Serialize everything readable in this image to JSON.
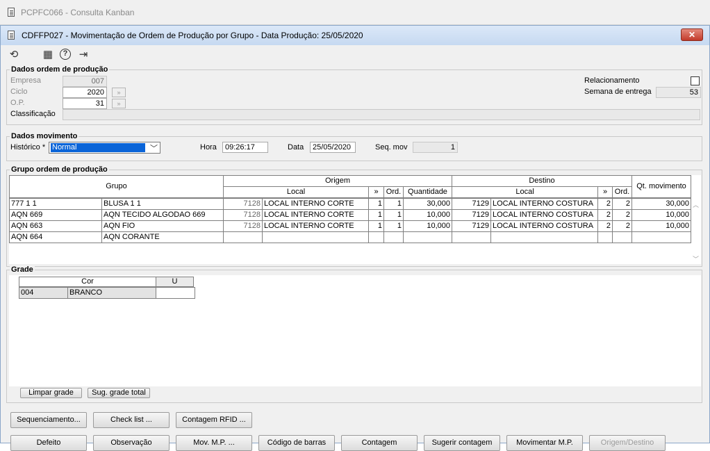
{
  "outer_window": {
    "title": "PCPFC066 - Consulta Kanban"
  },
  "window": {
    "title": "CDFFP027 - Movimentação de Ordem de Produção por Grupo - Data Produção: 25/05/2020",
    "close_symbol": "✕"
  },
  "toolbar": {
    "icons": [
      "refresh-icon",
      "calendar-icon",
      "help-icon",
      "exit-icon"
    ],
    "glyphs": {
      "refresh": "⟲",
      "calendar": "▦",
      "help": "?",
      "exit": "⇥"
    }
  },
  "dados_op": {
    "legend": "Dados ordem de produção",
    "empresa_label": "Empresa",
    "empresa_value": "007",
    "ciclo_label": "Ciclo",
    "ciclo_value": "2020",
    "op_label": "O.P.",
    "op_value": "31",
    "classificacao_label": "Classificação",
    "classificacao_value": "",
    "relacionamento_label": "Relacionamento",
    "relacionamento_checked": false,
    "semana_label": "Semana de entrega",
    "semana_value": "53",
    "spin_glyph": "»"
  },
  "dados_mov": {
    "legend": "Dados movimento",
    "historico_label": "Histórico *",
    "historico_value": "Normal",
    "hora_label": "Hora",
    "hora_value": "09:26:17",
    "data_label": "Data",
    "data_value": "25/05/2020",
    "seq_label": "Seq. mov",
    "seq_value": "1",
    "dropdown_glyph": "﹀"
  },
  "grupo_op": {
    "legend": "Grupo ordem de produção",
    "headers": {
      "grupo": "Grupo",
      "origem": "Origem",
      "destino": "Destino",
      "local": "Local",
      "arrows": "»",
      "ord": "Ord.",
      "quantidade": "Quantidade",
      "qt_movimento": "Qt. movimento"
    },
    "rows": [
      {
        "grupo_code": "777 1 1",
        "grupo_desc": "BLUSA 1 1",
        "orig_code": "7128",
        "orig_local": "LOCAL INTERNO CORTE",
        "orig_seq": "1",
        "orig_ord": "1",
        "quantidade": "30,000",
        "dest_code": "7129",
        "dest_local": "LOCAL INTERNO COSTURA",
        "dest_seq": "2",
        "dest_ord": "2",
        "qt_mov": "30,000"
      },
      {
        "grupo_code": "AQN 669",
        "grupo_desc": "AQN TECIDO ALGODAO 669",
        "orig_code": "7128",
        "orig_local": "LOCAL INTERNO CORTE",
        "orig_seq": "1",
        "orig_ord": "1",
        "quantidade": "10,000",
        "dest_code": "7129",
        "dest_local": "LOCAL INTERNO COSTURA",
        "dest_seq": "2",
        "dest_ord": "2",
        "qt_mov": "10,000"
      },
      {
        "grupo_code": "AQN 663",
        "grupo_desc": "AQN FIO",
        "orig_code": "7128",
        "orig_local": "LOCAL INTERNO CORTE",
        "orig_seq": "1",
        "orig_ord": "1",
        "quantidade": "10,000",
        "dest_code": "7129",
        "dest_local": "LOCAL INTERNO COSTURA",
        "dest_seq": "2",
        "dest_ord": "2",
        "qt_mov": "10,000"
      },
      {
        "grupo_code": "AQN 664",
        "grupo_desc": "AQN CORANTE",
        "orig_code": "",
        "orig_local": "",
        "orig_seq": "",
        "orig_ord": "",
        "quantidade": "",
        "dest_code": "",
        "dest_local": "",
        "dest_seq": "",
        "dest_ord": "",
        "qt_mov": ""
      }
    ],
    "scroll_up": "︿",
    "scroll_down": "﹀"
  },
  "grade": {
    "legend": "Grade",
    "headers": {
      "cor": "Cor",
      "u": "U"
    },
    "rows": [
      {
        "code": "004",
        "name": "BRANCO",
        "u": ""
      }
    ],
    "btn_limpar": "Limpar grade",
    "btn_sugerir": "Sug. grade total"
  },
  "buttons_row1": [
    "Sequenciamento...",
    "Check list ...",
    "Contagem RFID ..."
  ],
  "buttons_row2": [
    "Defeito",
    "Observação",
    "Mov. M.P. ...",
    "Código de barras",
    "Contagem",
    "Sugerir contagem",
    "Movimentar M.P.",
    "Origem/Destino"
  ]
}
